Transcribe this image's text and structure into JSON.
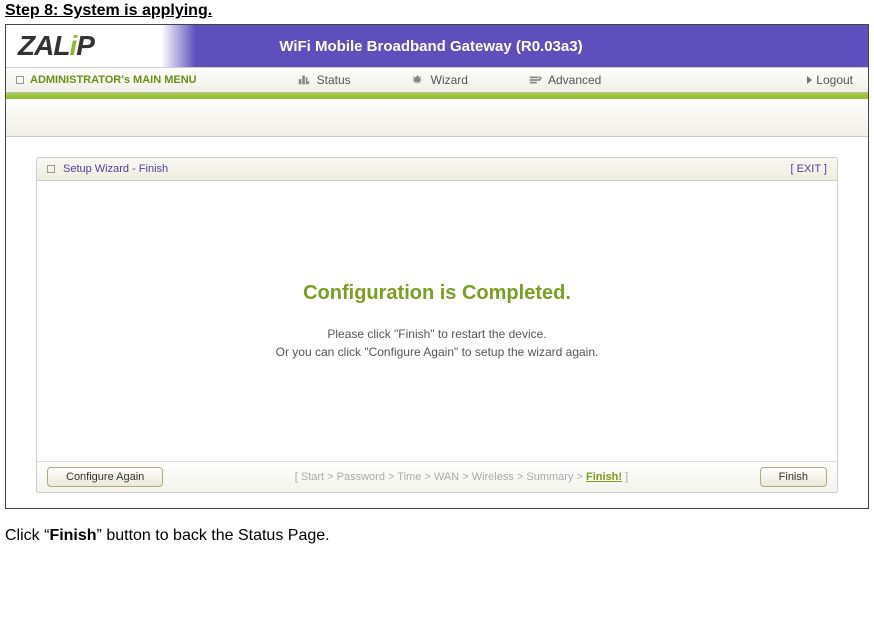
{
  "step_heading": "Step 8: System is applying.",
  "header": {
    "title": "WiFi Mobile Broadband Gateway (R0.03a3)"
  },
  "logo": {
    "prefix": "ZAL",
    "dot": "i",
    "suffix": "P"
  },
  "menu": {
    "main": "ADMINISTRATOR's MAIN MENU",
    "items": [
      {
        "label": "Status"
      },
      {
        "label": "Wizard"
      },
      {
        "label": "Advanced"
      }
    ],
    "logout": "Logout"
  },
  "panel": {
    "title": "Setup Wizard - Finish",
    "exit": "[ EXIT ]",
    "heading": "Configuration is Completed.",
    "note1": "Please click \"Finish\" to restart the device.",
    "note2": "Or you can click \"Configure Again\" to setup the wizard again."
  },
  "footer": {
    "configure_again": "Configure Again",
    "finish": "Finish",
    "crumbs": {
      "open": "[ ",
      "items": [
        "Start",
        "Password",
        "Time",
        "WAN",
        "Wireless",
        "Summary"
      ],
      "sep": " > ",
      "current": "Finish!",
      "close": " ]"
    }
  },
  "instruction": {
    "pre": "Click “",
    "bold": "Finish",
    "post": "” button to back the Status Page."
  }
}
